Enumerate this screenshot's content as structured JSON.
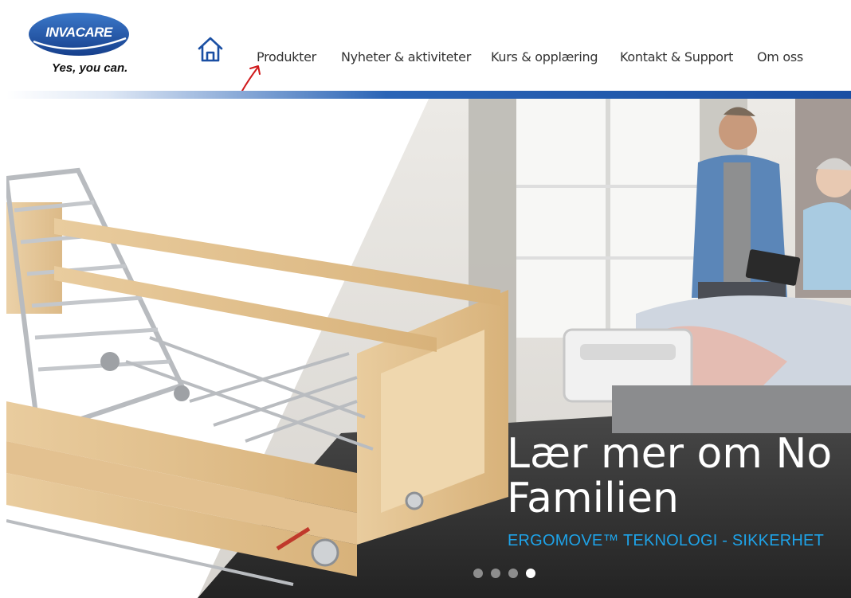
{
  "brand": {
    "logo_text": "INVACARE",
    "tagline": "Yes, you can."
  },
  "nav": {
    "home_icon": "home-icon",
    "items": [
      {
        "label": "Produkter"
      },
      {
        "label": "Nyheter & aktiviteter"
      },
      {
        "label": "Kurs & opplæring"
      },
      {
        "label": "Kontakt & Support"
      },
      {
        "label": "Om oss"
      }
    ]
  },
  "hero": {
    "heading_line1": "Lær mer om No",
    "heading_line2": "Familien",
    "subheading": "ERGOMOVE™ TEKNOLOGI - SIKKERHET",
    "slide_count": 4,
    "active_slide": 4
  },
  "colors": {
    "brand_blue": "#1a4fa3",
    "accent_cyan": "#1ea3e8",
    "annotation_red": "#d0191b"
  }
}
